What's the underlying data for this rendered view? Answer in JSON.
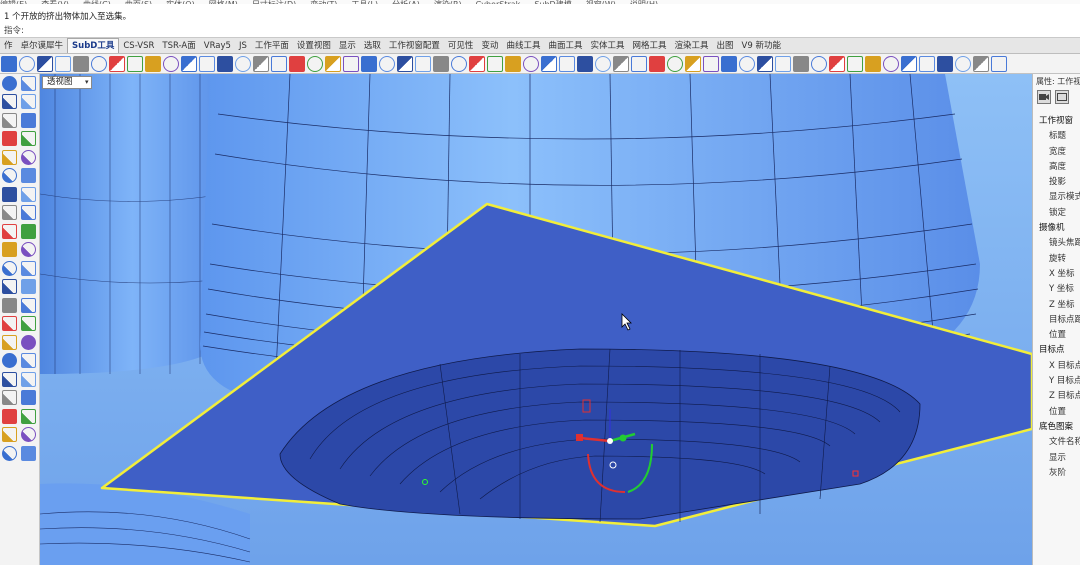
{
  "menu": [
    "编辑(E)",
    "查看(V)",
    "曲线(C)",
    "曲面(S)",
    "实体(O)",
    "网格(M)",
    "尺寸标注(D)",
    "变动(T)",
    "工具(L)",
    "分析(A)",
    "渲染(R)",
    "CyberStrak",
    "SubD建模",
    "视窗(W)",
    "说明(H)"
  ],
  "command": {
    "history": "1 个开放的挤出物体加入至选集。",
    "prompt": "指令:"
  },
  "tabs": [
    {
      "label": "作"
    },
    {
      "label": "卓尔谟犀牛"
    },
    {
      "label": "SubD工具",
      "active": true
    },
    {
      "label": "CS-VSR"
    },
    {
      "label": "TSR-A面"
    },
    {
      "label": "VRay5"
    },
    {
      "label": "JS"
    },
    {
      "label": "工作平面"
    },
    {
      "label": "设置视图"
    },
    {
      "label": "显示"
    },
    {
      "label": "选取"
    },
    {
      "label": "工作视窗配置"
    },
    {
      "label": "可见性"
    },
    {
      "label": "变动"
    },
    {
      "label": "曲线工具"
    },
    {
      "label": "曲面工具"
    },
    {
      "label": "实体工具"
    },
    {
      "label": "网格工具"
    },
    {
      "label": "渲染工具"
    },
    {
      "label": "出图"
    },
    {
      "label": "V9 新功能"
    }
  ],
  "viewport": {
    "label": "透视图",
    "dropdown_icon": "chevron-down-icon",
    "background": "#7fb2f0",
    "plane_color": "#3f5fc6",
    "plane_edge_color": "#f2ee3a",
    "mesh_color": "#1a2c66"
  },
  "properties_panel": {
    "title": "属性: 工作视窗",
    "icons": [
      "camera-icon",
      "viewport-icon"
    ],
    "rows": [
      {
        "type": "section",
        "label": "工作视窗"
      },
      {
        "type": "field",
        "label": "标题"
      },
      {
        "type": "field",
        "label": "宽度"
      },
      {
        "type": "field",
        "label": "高度"
      },
      {
        "type": "field",
        "label": "投影"
      },
      {
        "type": "field",
        "label": "显示模式"
      },
      {
        "type": "field",
        "label": "锁定"
      },
      {
        "type": "section",
        "label": "摄像机"
      },
      {
        "type": "field",
        "label": "镜头焦距"
      },
      {
        "type": "field",
        "label": "旋转"
      },
      {
        "type": "field",
        "label": "X 坐标"
      },
      {
        "type": "field",
        "label": "Y 坐标"
      },
      {
        "type": "field",
        "label": "Z 坐标"
      },
      {
        "type": "field",
        "label": "目标点距离"
      },
      {
        "type": "field",
        "label": "位置"
      },
      {
        "type": "section",
        "label": "目标点"
      },
      {
        "type": "field",
        "label": "X 目标点"
      },
      {
        "type": "field",
        "label": "Y 目标点"
      },
      {
        "type": "field",
        "label": "Z 目标点"
      },
      {
        "type": "field",
        "label": "位置"
      },
      {
        "type": "section",
        "label": "底色图案"
      },
      {
        "type": "field",
        "label": "文件名称"
      },
      {
        "type": "field",
        "label": "显示"
      },
      {
        "type": "field",
        "label": "灰阶"
      }
    ]
  },
  "toolbar_colors": [
    "#3a6fd0",
    "#5a8ae0",
    "#2d4fa0",
    "#6fa0e8",
    "#888888",
    "#4a7ad8",
    "#e04040",
    "#40a040",
    "#d8a020",
    "#7a50c0"
  ]
}
